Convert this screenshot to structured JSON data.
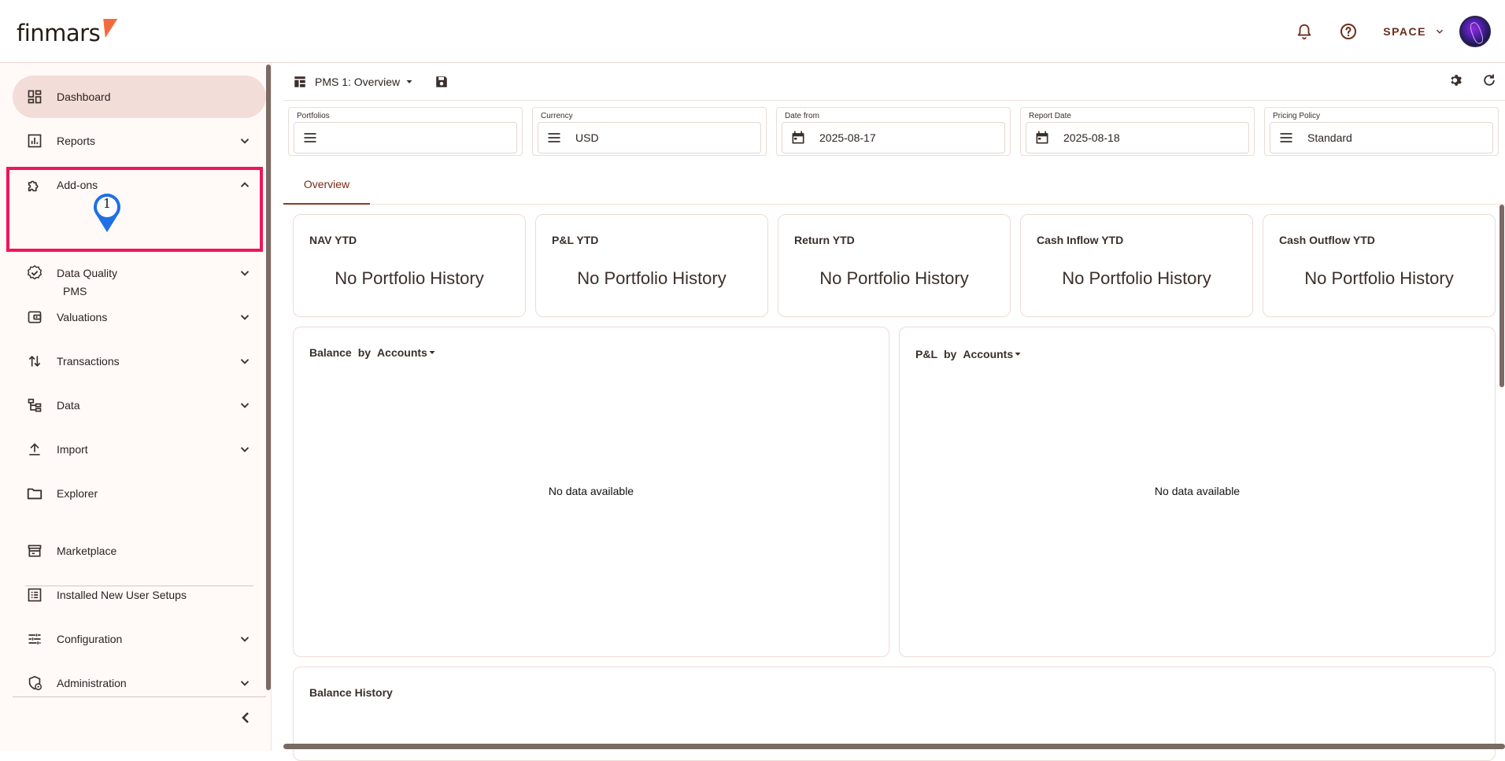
{
  "app": {
    "logo_text": "finmars"
  },
  "header": {
    "space_label": "SPACE"
  },
  "sidebar": {
    "items": [
      {
        "label": "Dashboard"
      },
      {
        "label": "Reports"
      },
      {
        "label": "Add-ons"
      },
      {
        "label": "Data Quality"
      },
      {
        "label": "Valuations"
      },
      {
        "label": "Transactions"
      },
      {
        "label": "Data"
      },
      {
        "label": "Import"
      },
      {
        "label": "Explorer"
      },
      {
        "label": "Marketplace"
      },
      {
        "label": "Installed New User Setups"
      },
      {
        "label": "Configuration"
      },
      {
        "label": "Administration"
      }
    ],
    "addons_sub": {
      "label": "PMS"
    },
    "marker_number": "1"
  },
  "toolbar": {
    "layout_label": "PMS 1: Overview"
  },
  "filters": [
    {
      "label": "Portfolios",
      "value": ""
    },
    {
      "label": "Currency",
      "value": "USD"
    },
    {
      "label": "Date from",
      "value": "2025-08-17"
    },
    {
      "label": "Report Date",
      "value": "2025-08-18"
    },
    {
      "label": "Pricing Policy",
      "value": "Standard"
    }
  ],
  "tabs": [
    {
      "label": "Overview"
    }
  ],
  "kpis": [
    {
      "title": "NAV YTD",
      "value": "No Portfolio History"
    },
    {
      "title": "P&L YTD",
      "value": "No Portfolio History"
    },
    {
      "title": "Return YTD",
      "value": "No Portfolio History"
    },
    {
      "title": "Cash Inflow YTD",
      "value": "No Portfolio History"
    },
    {
      "title": "Cash Outflow YTD",
      "value": "No Portfolio History"
    }
  ],
  "charts": [
    {
      "title": "Balance",
      "by": "by",
      "group": "Accounts",
      "empty": "No data available"
    },
    {
      "title": "P&L",
      "by": "by",
      "group": "Accounts",
      "empty": "No data available"
    },
    {
      "title": "Balance History"
    }
  ],
  "colors": {
    "accent": "#7a2a17",
    "highlight": "#ef1658",
    "marker": "#1f6fe5",
    "active_nav": "#f2ddd8"
  }
}
